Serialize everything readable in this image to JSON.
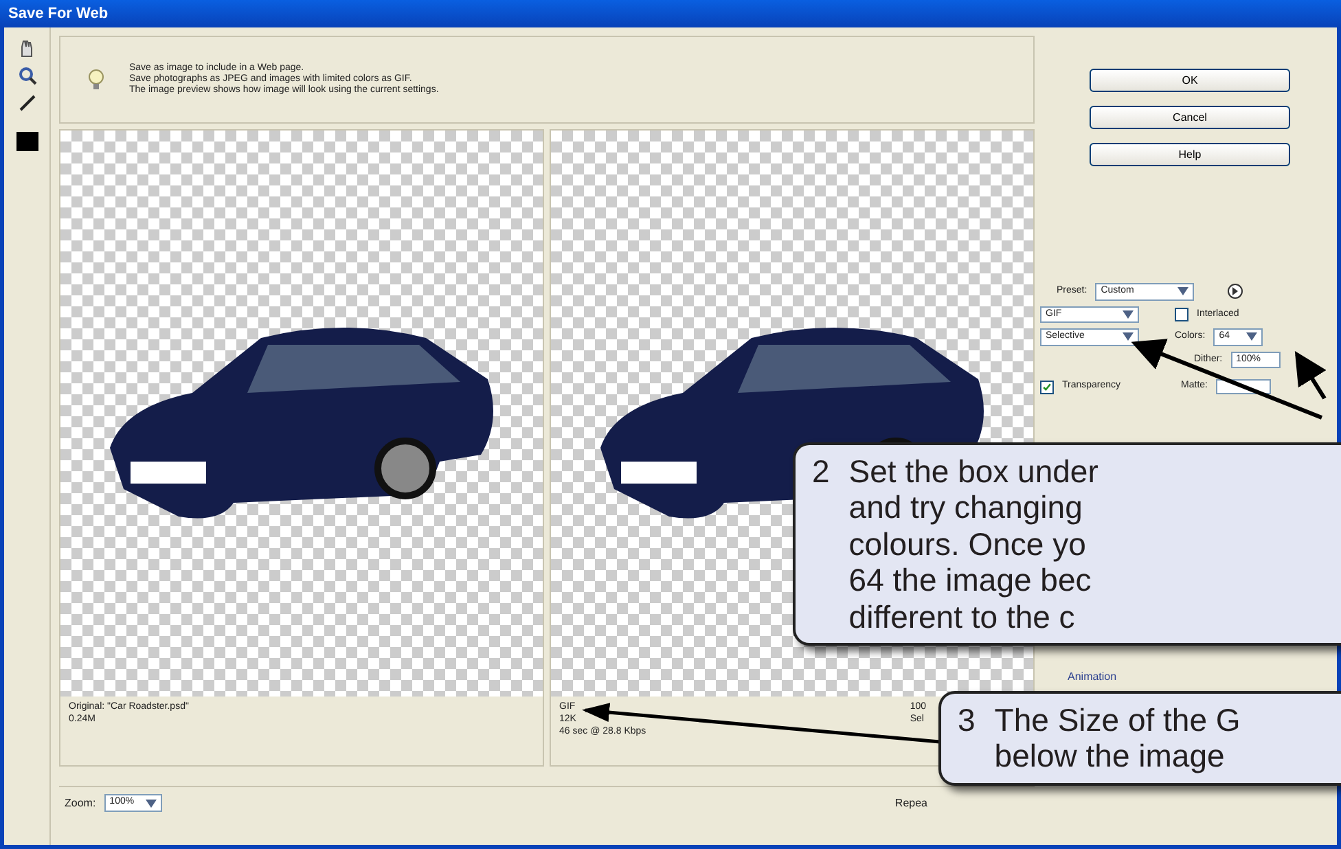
{
  "window": {
    "title": "Save For Web"
  },
  "tip": {
    "text": "Save as image to include in a Web page.\nSave photographs as JPEG and images with limited colors as GIF.\nThe image preview shows how image will look using the current settings."
  },
  "buttons": [
    "OK",
    "Cancel",
    "Help"
  ],
  "settings": {
    "preset_label": "Preset:",
    "preset": "Custom",
    "format": "GIF",
    "reduction": "Selective",
    "interlaced": {
      "label": "Interlaced",
      "checked": false
    },
    "colors_label": "Colors:",
    "colors": "64",
    "dither_label": "Dither:",
    "dither": "100%",
    "transparency": {
      "label": "Transparency",
      "checked": true
    },
    "matte_label": "Matte:",
    "animation_label": "Animation"
  },
  "previews": [
    {
      "info": [
        "Original: \"Car Roadster.psd\"",
        "0.24M"
      ]
    },
    {
      "info": [
        "GIF",
        "12K",
        "46 sec @ 28.8 Kbps"
      ]
    }
  ],
  "third_info": [
    "100",
    "Sel"
  ],
  "zoom": {
    "label": "Zoom:",
    "value": "100%"
  },
  "repeat_label": "Repea",
  "callouts": [
    {
      "number": "2",
      "text": "Set the box under\nand try changing\ncolours.  Once yo\n64 the image bec\ndifferent to the c"
    },
    {
      "number": "3",
      "text": "The Size of the G\nbelow the image"
    }
  ]
}
